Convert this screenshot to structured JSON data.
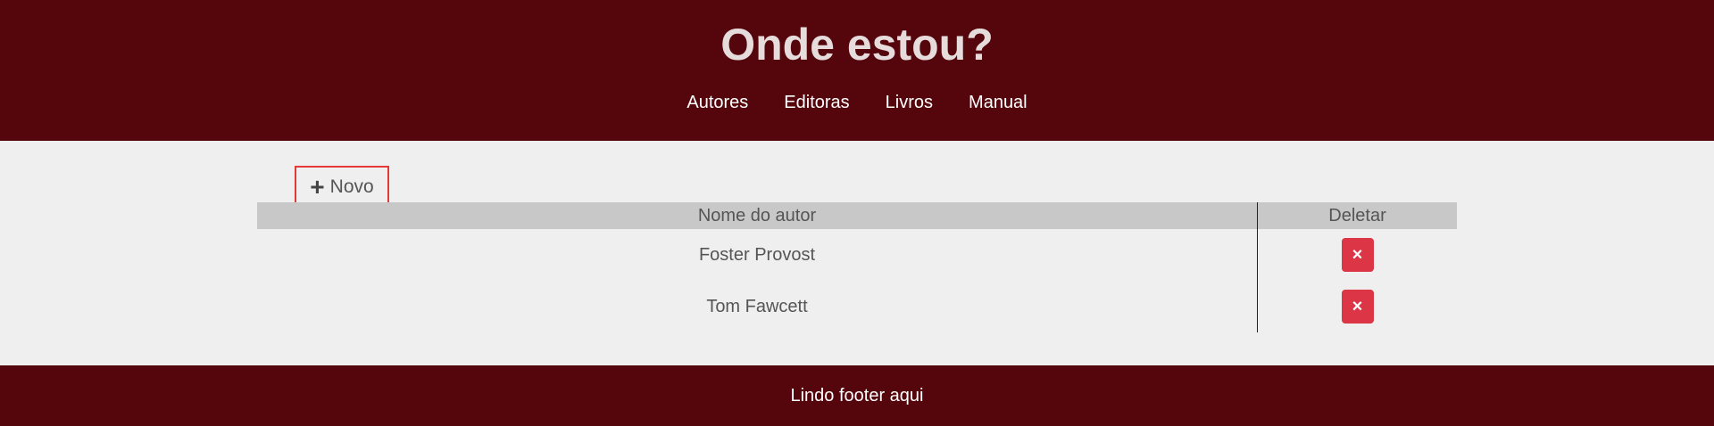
{
  "header": {
    "title": "Onde estou?",
    "nav": [
      "Autores",
      "Editoras",
      "Livros",
      "Manual"
    ]
  },
  "toolbar": {
    "new_icon": "+",
    "new_label": "Novo"
  },
  "table": {
    "columns": [
      "Nome do autor",
      "Deletar"
    ],
    "rows": [
      {
        "name": "Foster Provost",
        "delete_icon": "×"
      },
      {
        "name": "Tom Fawcett",
        "delete_icon": "×"
      }
    ]
  },
  "footer": {
    "text": "Lindo footer aqui"
  },
  "colors": {
    "header_bg": "#55060d",
    "page_bg": "#efefef",
    "table_header_bg": "#c8c8c8",
    "delete_button": "#dc3545",
    "focus_outline": "#e53935"
  },
  "icons": {
    "new": "plus-icon",
    "delete": "close-icon"
  }
}
